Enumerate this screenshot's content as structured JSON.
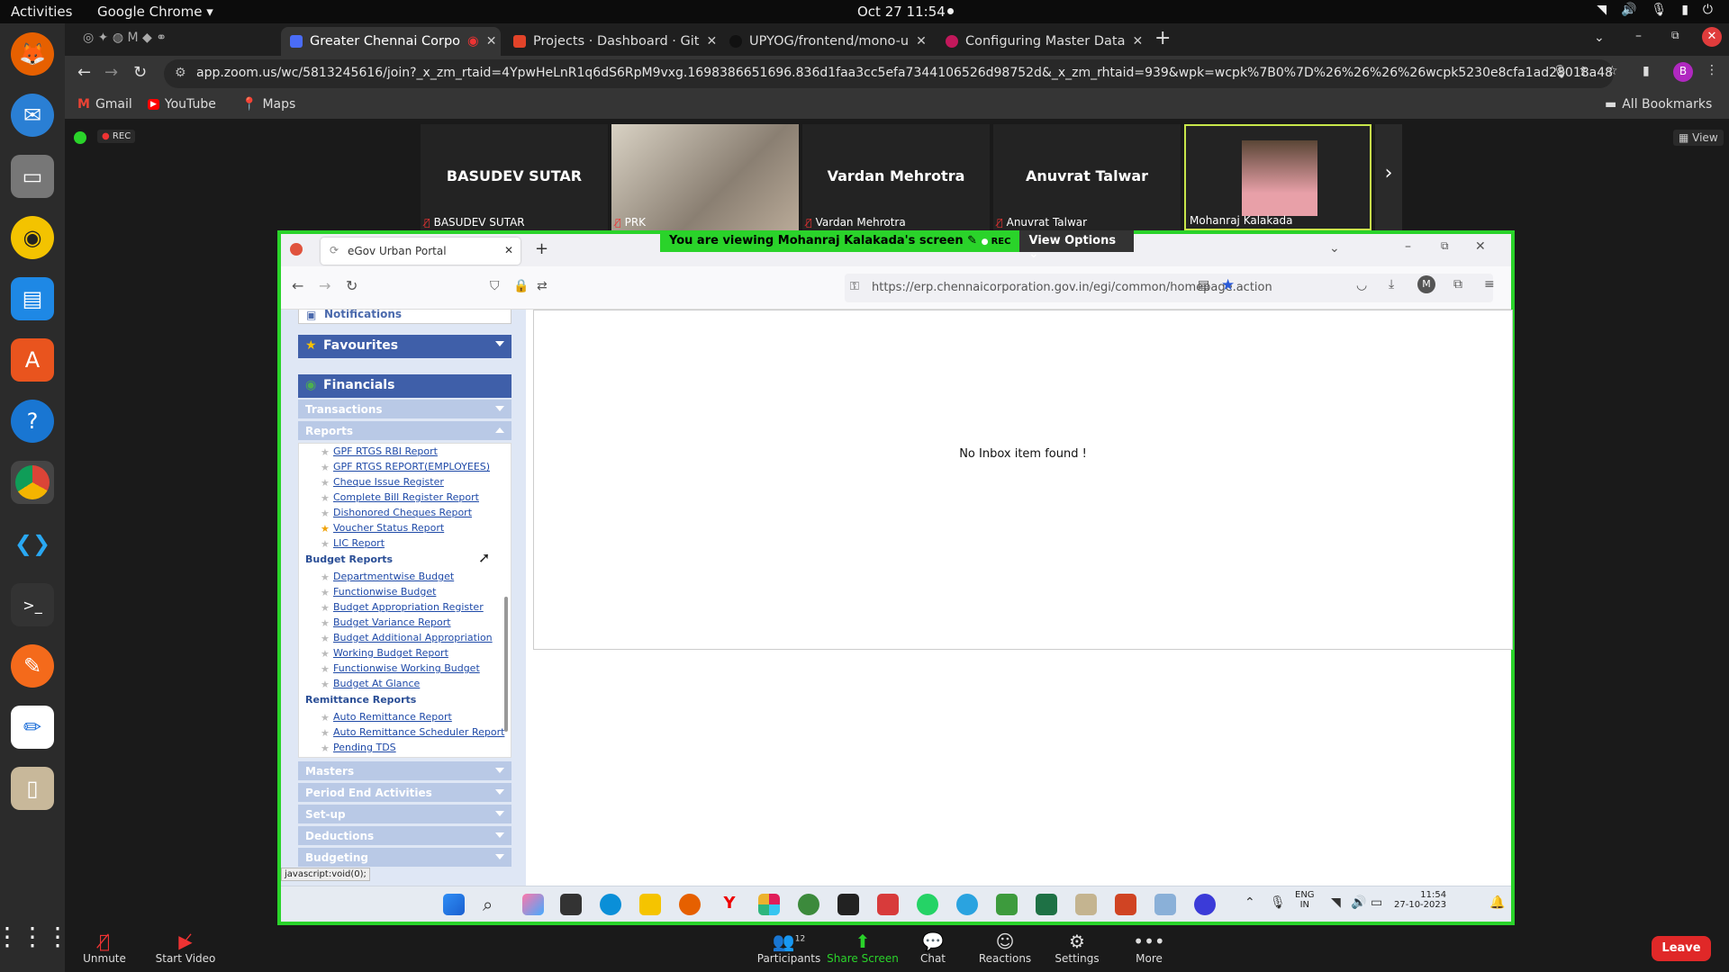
{
  "topbar": {
    "activities": "Activities",
    "app": "Google Chrome",
    "clock": "Oct 27  11:54"
  },
  "chrome": {
    "tabs": [
      {
        "label": "Greater Chennai Corpo",
        "color": "#4a6cf7"
      },
      {
        "label": "Projects · Dashboard · Git",
        "color": "#e24329"
      },
      {
        "label": "UPYOG/frontend/mono-u",
        "color": "#222222"
      },
      {
        "label": "Configuring Master Data",
        "color": "#c2185b"
      }
    ],
    "url": "app.zoom.us/wc/5813245616/join?_x_zm_rtaid=4YpwHeLnR1q6dS6RpM9vxg.1698386651696.836d1faa3cc5efa7344106526d98752d&_x_zm_rhtaid=939&wpk=wcpk%7B0%7D%26%26%26%26wcpk5230e8cfa1ad28018a4876bd4df04...",
    "bookmarks": [
      "Gmail",
      "YouTube",
      "Maps"
    ],
    "all_bookmarks": "All Bookmarks",
    "profile_initial": "B"
  },
  "zoom": {
    "rec": "REC",
    "view": "View",
    "participants_tiles": [
      {
        "name": "BASUDEV SUTAR",
        "label": "BASUDEV SUTAR"
      },
      {
        "name": "",
        "label": "PRK"
      },
      {
        "name": "Vardan Mehrotra",
        "label": "Vardan Mehrotra"
      },
      {
        "name": "Anuvrat Talwar",
        "label": "Anuvrat Talwar"
      },
      {
        "name": "",
        "label": "Mohanraj Kalakada"
      }
    ],
    "banner": "You are viewing  Mohanraj Kalakada's screen",
    "banner_rec": "REC",
    "view_options": "View Options",
    "controls": {
      "unmute": "Unmute",
      "start_video": "Start Video",
      "participants": "Participants",
      "participants_count": "12",
      "share": "Share Screen",
      "chat": "Chat",
      "reactions": "Reactions",
      "settings": "Settings",
      "more": "More",
      "leave": "Leave"
    }
  },
  "shared": {
    "tab_title": "eGov Urban Portal",
    "url": "https://erp.chennaicorporation.gov.in/egi/common/homepage.action",
    "notifications": "Notifications",
    "favourites": "Favourites",
    "financials": "Financials",
    "transactions": "Transactions",
    "reports": "Reports",
    "report_items": [
      "GPF RTGS RBI Report",
      "GPF RTGS REPORT(EMPLOYEES)",
      "Cheque Issue Register",
      "Complete Bill Register Report",
      "Dishonored Cheques Report",
      "Voucher Status Report",
      "LIC Report"
    ],
    "budget_reports": "Budget Reports",
    "budget_items": [
      "Departmentwise Budget",
      "Functionwise Budget",
      "Budget Appropriation Register",
      "Budget Variance Report",
      "Budget Additional Appropriation",
      "Working Budget Report",
      "Functionwise Working Budget",
      "Budget At Glance"
    ],
    "remittance_reports": "Remittance Reports",
    "remittance_items": [
      "Auto Remittance Report",
      "Auto Remittance Scheduler Report",
      "Pending TDS"
    ],
    "lower_menus": [
      "Masters",
      "Period End Activities",
      "Set-up",
      "Deductions",
      "Budgeting"
    ],
    "status": "javascript:void(0);",
    "empty_msg": "No Inbox item found !",
    "win_clock": {
      "time": "11:54",
      "date": "27-10-2023",
      "lang1": "ENG",
      "lang2": "IN"
    }
  }
}
